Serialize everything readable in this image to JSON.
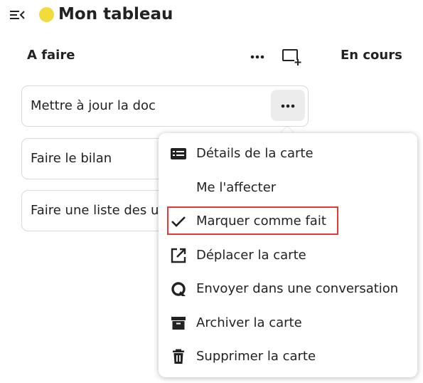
{
  "header": {
    "board_title": "Mon tableau",
    "board_color": "#f2dc3c",
    "menu_toggle_icon": "menu-collapse-icon"
  },
  "columns": [
    {
      "title": "A faire",
      "more_icon": "more-horizontal-icon",
      "add_icon": "add-card-icon",
      "cards": [
        {
          "title": "Mettre à jour la doc",
          "menu_open": true
        },
        {
          "title": "Faire le bilan"
        },
        {
          "title": "Faire une liste des u"
        }
      ]
    },
    {
      "title": "En cours"
    }
  ],
  "card_menu": {
    "items": [
      {
        "label": "Détails de la carte",
        "icon": "card-details-icon"
      },
      {
        "label": "Me l'affecter",
        "icon": ""
      },
      {
        "label": "Marquer comme fait",
        "icon": "check-icon",
        "highlighted": true
      },
      {
        "label": "Déplacer la carte",
        "icon": "open-external-icon"
      },
      {
        "label": "Envoyer dans une conversation",
        "icon": "talk-icon"
      },
      {
        "label": "Archiver la carte",
        "icon": "archive-icon"
      },
      {
        "label": "Supprimer la carte",
        "icon": "trash-icon"
      }
    ]
  },
  "colors": {
    "highlight": "#e53935",
    "text": "#222222"
  }
}
